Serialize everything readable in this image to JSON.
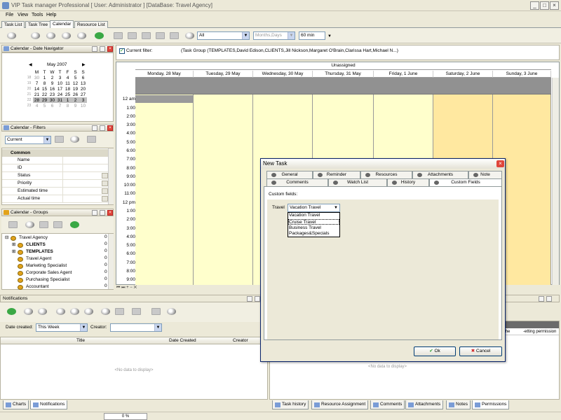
{
  "window": {
    "title": "VIP Task manager Professional [ User: Administrator ] [DataBase: Travel Agency]"
  },
  "menu": [
    "File",
    "View",
    "Tools",
    "Help"
  ],
  "tabs": [
    "Task List",
    "Task Tree",
    "Calendar",
    "Resource List"
  ],
  "toolbar": {
    "filter_value": "All",
    "period_value": "Months,Days",
    "scale_value": "60 min"
  },
  "date_navigator": {
    "title": "Calendar - Date Navigator",
    "month": "May 2007",
    "weekdays": [
      "M",
      "T",
      "W",
      "T",
      "F",
      "S",
      "S"
    ],
    "weeks": [
      {
        "wk": "18",
        "days": [
          "30",
          "1",
          "2",
          "3",
          "4",
          "5",
          "6"
        ]
      },
      {
        "wk": "19",
        "days": [
          "7",
          "8",
          "9",
          "10",
          "11",
          "12",
          "13"
        ]
      },
      {
        "wk": "20",
        "days": [
          "14",
          "15",
          "16",
          "17",
          "18",
          "19",
          "20"
        ]
      },
      {
        "wk": "21",
        "days": [
          "21",
          "22",
          "23",
          "24",
          "25",
          "26",
          "27"
        ]
      },
      {
        "wk": "22",
        "days": [
          "28",
          "29",
          "30",
          "31",
          "1",
          "2",
          "3"
        ]
      },
      {
        "wk": "23",
        "days": [
          "4",
          "5",
          "6",
          "7",
          "8",
          "9",
          "10"
        ]
      }
    ]
  },
  "filters": {
    "title": "Calendar - Filters",
    "current": "Current",
    "section": "Common",
    "rows": [
      "Name",
      "ID",
      "Status",
      "Priority",
      "Estimated time",
      "Actual time"
    ]
  },
  "groups": {
    "title": "Calendar - Groups",
    "items": [
      {
        "label": "Travel Agency",
        "count": "0"
      },
      {
        "label": "CLIENTS",
        "count": "0"
      },
      {
        "label": "TEMPLATES",
        "count": "0"
      },
      {
        "label": "Travel Agent",
        "count": "0"
      },
      {
        "label": "Marketing Specialist",
        "count": "0"
      },
      {
        "label": "Corporate Sales Agent",
        "count": "0"
      },
      {
        "label": "Purchasing Specialist",
        "count": "0"
      },
      {
        "label": "Accountant",
        "count": "0"
      }
    ]
  },
  "calendar": {
    "filter_label": "Current filter:",
    "filter_text": "(Task Group  (TEMPLATES,David Edison,CLIENTS,Jill Nickson,Margaret O'Brain,Clarissa Hart,Michael N...)",
    "resource": "Unassigned",
    "days": [
      "Monday, 28 May",
      "Tuesday, 29 May",
      "Wednesday, 30 May",
      "Thursday, 31 May",
      "Friday, 1 June",
      "Saturday, 2 June",
      "Sunday, 3 June"
    ],
    "hours": [
      "12 am",
      "1:00",
      "2:00",
      "3:00",
      "4:00",
      "5:00",
      "6:00",
      "7:00",
      "8:00",
      "9:00",
      "10:00",
      "11:00",
      "12 pm",
      "1:00",
      "2:00",
      "3:00",
      "4:00",
      "5:00",
      "6:00",
      "7:00",
      "8:00",
      "9:00"
    ]
  },
  "notifications": {
    "title": "Notifications",
    "date_created_label": "Date created:",
    "date_created_value": "This Week",
    "creator_label": "Creator:",
    "columns": [
      "Title",
      "Date Created",
      "Creator"
    ],
    "empty": "<No data to display>"
  },
  "right_panel": {
    "col1": "the",
    "col2": "-etting permission",
    "empty": "<No data to display>"
  },
  "bottom_tabs_left": [
    "Charts",
    "Notifications"
  ],
  "bottom_tabs_right": [
    "Task history",
    "Resource Assignment",
    "Comments",
    "Attachments",
    "Notes",
    "Permissions"
  ],
  "status": {
    "progress": "0 %"
  },
  "dialog": {
    "title": "New Task",
    "tabs_row1": [
      "General",
      "Reminder",
      "Resources",
      "Attachments",
      "Note"
    ],
    "tabs_row2": [
      "Comments",
      "Watch List",
      "History",
      "Custom Fields"
    ],
    "section": "Custom fields:",
    "field_label": "Travel",
    "field_value": "Vacation Travel",
    "options": [
      "Vacation Travel",
      "Cruise Travel",
      "Business Travel",
      "Packages&Specials"
    ],
    "ok": "Ok",
    "cancel": "Cancel"
  }
}
